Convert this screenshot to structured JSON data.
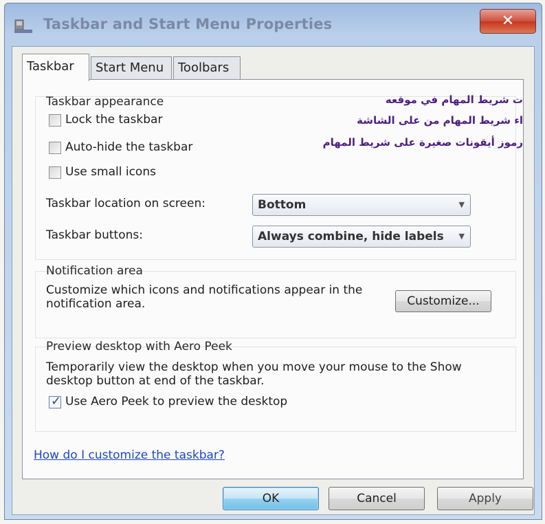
{
  "window": {
    "title": "Taskbar and Start Menu Properties",
    "close_label": "✕"
  },
  "tabs": [
    {
      "label": "Taskbar",
      "active": true
    },
    {
      "label": "Start Menu",
      "active": false
    },
    {
      "label": "Toolbars",
      "active": false
    }
  ],
  "appearance": {
    "title": "Taskbar appearance",
    "lock_label": "Lock the taskbar",
    "lock_checked": false,
    "autohide_label": "Auto-hide the taskbar",
    "autohide_checked": false,
    "smallicons_label": "Use small icons",
    "smallicons_checked": false,
    "location_label": "Taskbar location on screen:",
    "location_value": "Bottom",
    "buttons_label": "Taskbar buttons:",
    "buttons_value": "Always combine, hide labels"
  },
  "annotations": [
    "ت شريط المهام في موقعه",
    "اء شريط المهام من على الشاشة",
    "رموز أيقونات صغيرة على شريط المهام"
  ],
  "notification": {
    "title": "Notification area",
    "description": "Customize which icons and notifications appear in the notification area.",
    "customize_label": "Customize..."
  },
  "aero": {
    "title": "Preview desktop with Aero Peek",
    "description": "Temporarily view the desktop when you move your mouse to the Show desktop button at end of the taskbar.",
    "checkbox_label": "Use Aero Peek to preview the desktop",
    "checked": true
  },
  "help_link": "How do I customize the taskbar?",
  "footer": {
    "ok_label": "OK",
    "cancel_label": "Cancel",
    "apply_label": "Apply"
  },
  "icons": {
    "app": "taskbar-properties-icon",
    "close": "close-icon",
    "dropdown": "chevron-down-icon",
    "checkmark": "checkmark-icon"
  }
}
